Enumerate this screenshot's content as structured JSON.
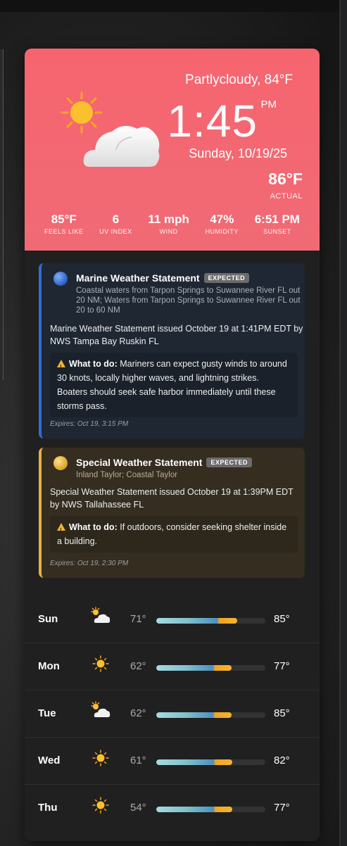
{
  "current": {
    "condition": "Partlycloudy, 84°F",
    "time": "1:45",
    "ampm": "PM",
    "date": "Sunday, 10/19/25",
    "actual_temp": "86°F",
    "actual_label": "ACTUAL",
    "icon": "partly-cloudy-icon",
    "stats": [
      {
        "value": "85°F",
        "label": "FEELS LIKE"
      },
      {
        "value": "6",
        "label": "UV INDEX"
      },
      {
        "value": "11 mph",
        "label": "WIND"
      },
      {
        "value": "47%",
        "label": "HUMIDITY"
      },
      {
        "value": "6:51 PM",
        "label": "SUNSET"
      }
    ]
  },
  "alerts": [
    {
      "title": "Marine Weather Statement",
      "badge": "EXPECTED",
      "area": "Coastal waters from Tarpon Springs to Suwannee River FL out 20 NM; Waters from Tarpon Springs to Suwannee River FL out 20 to 60 NM",
      "description": "Marine Weather Statement issued October 19 at 1:41PM EDT by NWS Tampa Bay Ruskin FL",
      "todo_label": "What to do:",
      "todo_text": "Mariners can expect gusty winds to around 30 knots, locally higher waves, and lightning strikes. Boaters should seek safe harbor immediately until these storms pass.",
      "expires": "Expires: Oct 19, 3:15 PM",
      "color": "#2f6fd0"
    },
    {
      "title": "Special Weather Statement",
      "badge": "EXPECTED",
      "area": "Inland Taylor; Coastal Taylor",
      "description": "Special Weather Statement issued October 19 at 1:39PM EDT by NWS Tallahassee FL",
      "todo_label": "What to do:",
      "todo_text": "If outdoors, consider seeking shelter inside a building.",
      "expires": "Expires: Oct 19, 2:30 PM",
      "color": "#e0b442"
    }
  ],
  "forecast": [
    {
      "day": "Sun",
      "icon": "partly-cloudy-icon",
      "low": "71°",
      "high": "85°"
    },
    {
      "day": "Mon",
      "icon": "sunny-icon",
      "low": "62°",
      "high": "77°"
    },
    {
      "day": "Tue",
      "icon": "partly-cloudy-icon",
      "low": "62°",
      "high": "85°"
    },
    {
      "day": "Wed",
      "icon": "sunny-icon",
      "low": "61°",
      "high": "82°"
    },
    {
      "day": "Thu",
      "icon": "sunny-icon",
      "low": "54°",
      "high": "77°"
    }
  ]
}
